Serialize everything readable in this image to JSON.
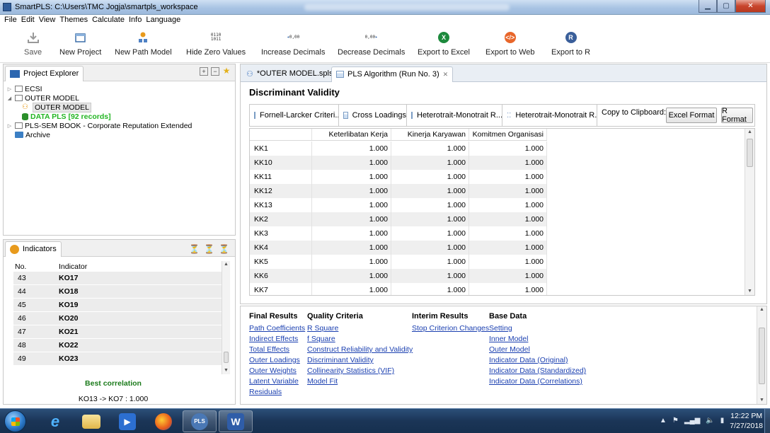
{
  "window": {
    "title": "SmartPLS: C:\\Users\\TMC Jogja\\smartpls_workspace"
  },
  "menu": [
    "File",
    "Edit",
    "View",
    "Themes",
    "Calculate",
    "Info",
    "Language"
  ],
  "toolbar": {
    "save": "Save",
    "new_project": "New Project",
    "new_path_model": "New Path Model",
    "hide_zero_values": "Hide Zero Values",
    "increase_decimals": "Increase Decimals",
    "decrease_decimals": "Decrease Decimals",
    "export_excel": "Export to Excel",
    "export_web": "Export to Web",
    "export_r": "Export to R",
    "hide_zero_glyph": [
      "0110",
      "1011"
    ],
    "inc_dec_glyph": [
      "0,00"
    ],
    "dec_dec_glyph": [
      "0,00"
    ]
  },
  "project_explorer": {
    "tab": "Project Explorer",
    "items": {
      "ecsi": "ECSI",
      "outer_model": "OUTER MODEL",
      "outer_model_child": "OUTER MODEL",
      "data_pls": "DATA PLS [92 records]",
      "pls_sem_book": "PLS-SEM BOOK - Corporate Reputation Extended",
      "archive": "Archive"
    }
  },
  "indicators": {
    "tab": "Indicators",
    "col_no": "No.",
    "col_indicator": "Indicator",
    "rows": [
      {
        "no": "43",
        "name": "KO17"
      },
      {
        "no": "44",
        "name": "KO18"
      },
      {
        "no": "45",
        "name": "KO19"
      },
      {
        "no": "46",
        "name": "KO20"
      },
      {
        "no": "47",
        "name": "KO21"
      },
      {
        "no": "48",
        "name": "KO22"
      },
      {
        "no": "49",
        "name": "KO23"
      }
    ],
    "best_correlation_label": "Best correlation",
    "best_correlation_value": "KO13 -> KO7 : 1.000"
  },
  "editor": {
    "tabs": {
      "outer_model": "*OUTER MODEL.splsm",
      "algorithm": "PLS Algorithm (Run No. 3)",
      "algorithm_close": "✕"
    },
    "section_title": "Discriminant Validity",
    "result_tabs": {
      "fornell": "Fornell-Larcker Criteri...",
      "cross_loadings": "Cross Loadings",
      "htmt1": "Heterotrait-Monotrait R...",
      "htmt2": "Heterotrait-Monotrait R..."
    },
    "copy_label": "Copy to Clipboard:",
    "excel_format": "Excel Format",
    "r_format": "R Format",
    "grid": {
      "columns": [
        "Keterlibatan Kerja",
        "Kinerja Karyawan",
        "Komitmen Organisasi"
      ],
      "rows": [
        {
          "label": "KK1",
          "v": [
            "1.000",
            "1.000",
            "1.000"
          ]
        },
        {
          "label": "KK10",
          "v": [
            "1.000",
            "1.000",
            "1.000"
          ]
        },
        {
          "label": "KK11",
          "v": [
            "1.000",
            "1.000",
            "1.000"
          ]
        },
        {
          "label": "KK12",
          "v": [
            "1.000",
            "1.000",
            "1.000"
          ]
        },
        {
          "label": "KK13",
          "v": [
            "1.000",
            "1.000",
            "1.000"
          ]
        },
        {
          "label": "KK2",
          "v": [
            "1.000",
            "1.000",
            "1.000"
          ]
        },
        {
          "label": "KK3",
          "v": [
            "1.000",
            "1.000",
            "1.000"
          ]
        },
        {
          "label": "KK4",
          "v": [
            "1.000",
            "1.000",
            "1.000"
          ]
        },
        {
          "label": "KK5",
          "v": [
            "1.000",
            "1.000",
            "1.000"
          ]
        },
        {
          "label": "KK6",
          "v": [
            "1.000",
            "1.000",
            "1.000"
          ]
        },
        {
          "label": "KK7",
          "v": [
            "1.000",
            "1.000",
            "1.000"
          ]
        }
      ]
    }
  },
  "results": {
    "final": {
      "header": "Final Results",
      "links": [
        "Path Coefficients",
        "Indirect Effects",
        "Total Effects",
        "Outer Loadings",
        "Outer Weights",
        "Latent Variable",
        "Residuals"
      ]
    },
    "quality": {
      "header": "Quality Criteria",
      "links": [
        "R Square",
        "f Square",
        "Construct Reliability and Validity",
        "Discriminant Validity",
        "Collinearity Statistics (VIF)",
        "Model Fit"
      ]
    },
    "interim": {
      "header": "Interim Results",
      "links": [
        "Stop Criterion Changes"
      ]
    },
    "base": {
      "header": "Base Data",
      "links": [
        "Setting",
        "Inner Model",
        "Outer Model",
        "Indicator Data (Original)",
        "Indicator Data (Standardized)",
        "Indicator Data (Correlations)"
      ]
    }
  },
  "taskbar": {
    "clock_time": "12:22 PM",
    "clock_date": "7/27/2018",
    "items": [
      "windows-start",
      "internet-explorer",
      "file-explorer",
      "media-player",
      "firefox",
      "smartpls",
      "word"
    ]
  },
  "colors": {
    "link": "#1a3fb0",
    "data_pls": "#22b522",
    "best_corr": "#1a7a1a",
    "taskbar": "#1b3557"
  }
}
